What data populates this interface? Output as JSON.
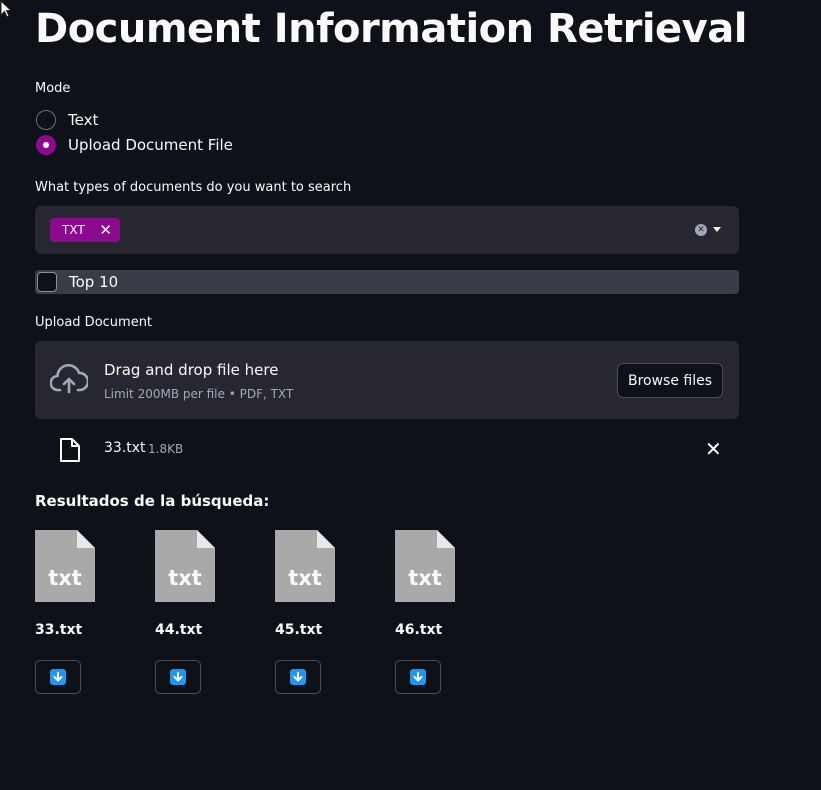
{
  "page": {
    "title": "Document Information Retrieval"
  },
  "mode": {
    "label": "Mode",
    "options": [
      {
        "label": "Text",
        "selected": false
      },
      {
        "label": "Upload Document File",
        "selected": true
      }
    ]
  },
  "doc_types": {
    "label": "What types of documents do you want to search",
    "selected_tags": [
      "TXT"
    ]
  },
  "top10": {
    "label": "Top 10",
    "checked": false
  },
  "upload": {
    "label": "Upload Document",
    "dropzone_title": "Drag and drop file here",
    "dropzone_sub": "Limit 200MB per file • PDF, TXT",
    "browse_label": "Browse files",
    "file": {
      "name": "33.txt",
      "size": "1.8KB"
    }
  },
  "results": {
    "title": "Resultados de la búsqueda:",
    "items": [
      {
        "name": "33.txt",
        "thumb_text": "txt"
      },
      {
        "name": "44.txt",
        "thumb_text": "txt"
      },
      {
        "name": "45.txt",
        "thumb_text": "txt"
      },
      {
        "name": "46.txt",
        "thumb_text": "txt"
      }
    ]
  },
  "colors": {
    "background": "#0e1117",
    "accent": "#8b0a8e",
    "widget_bg": "#262730",
    "download_icon": "#2196f3"
  }
}
